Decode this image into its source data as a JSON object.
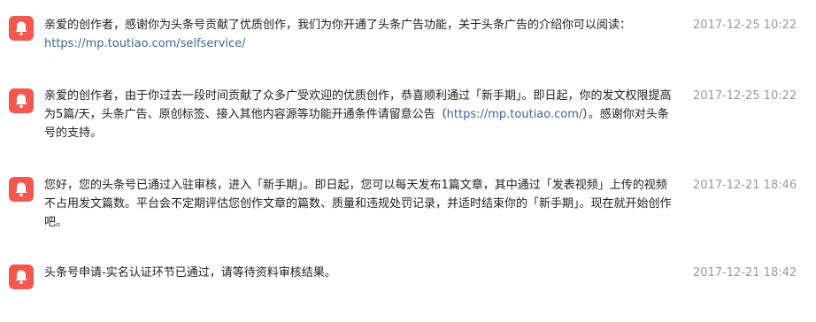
{
  "messages": [
    {
      "text_before": "亲爱的创作者，感谢你为头条号贡献了优质创作，我们为你开通了头条广告功能，关于头条广告的介绍你可以阅读：",
      "link": "https://mp.toutiao.com/selfservice/",
      "text_after": "",
      "time": "2017-12-25 10:22",
      "icon": "bell-icon"
    },
    {
      "text_before": "亲爱的创作者，由于你过去一段时间贡献了众多广受欢迎的优质创作，恭喜顺利通过「新手期」。即日起，你的发文权限提高为5篇/天，头条广告、原创标签、接入其他内容源等功能开通条件请留意公告（",
      "link": "https://mp.toutiao.com/",
      "text_after": "）。感谢你对头条号的支持。",
      "time": "2017-12-25 10:22",
      "icon": "bell-icon"
    },
    {
      "text_before": "您好，您的头条号已通过入驻审核，进入「新手期」。即日起，您可以每天发布1篇文章，其中通过「发表视频」上传的视频不占用发文篇数。平台会不定期评估您创作文章的篇数、质量和违规处罚记录，并适时结束你的「新手期」。现在就开始创作吧。",
      "link": "",
      "text_after": "",
      "time": "2017-12-21 18:46",
      "icon": "bell-icon"
    },
    {
      "text_before": "头条号申请-实名认证环节已通过，请等待资料审核结果。",
      "link": "",
      "text_after": "",
      "time": "2017-12-21 18:42",
      "icon": "bell-icon"
    }
  ],
  "colors": {
    "icon_bg": "#f3584e",
    "link": "#406599",
    "time": "#999999"
  }
}
